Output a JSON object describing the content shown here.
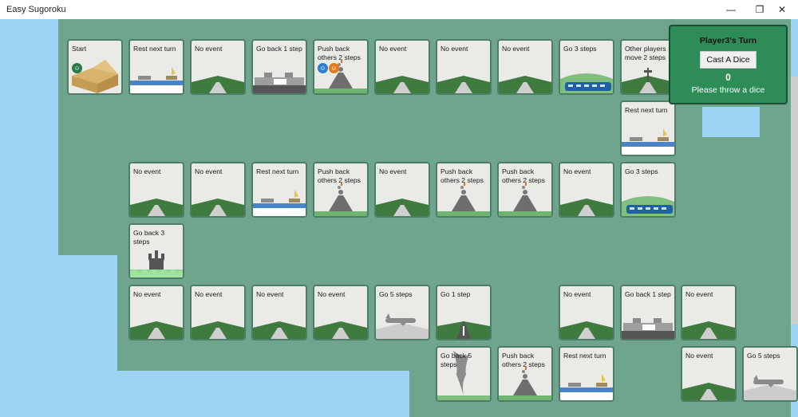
{
  "window": {
    "title": "Easy Sugoroku"
  },
  "panel": {
    "turn_text": "Player3's Turn",
    "cast_button": "Cast A Dice",
    "dice_value": "0",
    "message": "Please throw a dice"
  },
  "tiles": [
    {
      "label": "Start",
      "art": "box",
      "pawns": [
        "green"
      ]
    },
    {
      "label": "Rest next turn",
      "art": "sea"
    },
    {
      "label": "No event",
      "art": "road"
    },
    {
      "label": "Go back 1 step",
      "art": "traffic"
    },
    {
      "label": "Push back\nothers 2 steps",
      "art": "volcano",
      "pawns": [
        "blue",
        "orange"
      ]
    },
    {
      "label": "No event",
      "art": "road"
    },
    {
      "label": "No event",
      "art": "road"
    },
    {
      "label": "No event",
      "art": "road"
    },
    {
      "label": "Go 3 steps",
      "art": "train"
    },
    {
      "label": "Other players\nmove 2 steps",
      "art": "sign"
    },
    {
      "label": "Rest next turn",
      "art": "sea"
    },
    {
      "label": "No event",
      "art": "road"
    },
    {
      "label": "No event",
      "art": "road"
    },
    {
      "label": "Rest next turn",
      "art": "sea"
    },
    {
      "label": "Push back\nothers 2 steps",
      "art": "volcano"
    },
    {
      "label": "No event",
      "art": "road"
    },
    {
      "label": "Push back\nothers 2 steps",
      "art": "volcano"
    },
    {
      "label": "Push back\nothers 2 steps",
      "art": "volcano"
    },
    {
      "label": "No event",
      "art": "road"
    },
    {
      "label": "Go 3 steps",
      "art": "train"
    },
    {
      "label": "Go back 3 steps",
      "art": "castle"
    },
    {
      "label": "No event",
      "art": "road"
    },
    {
      "label": "No event",
      "art": "road"
    },
    {
      "label": "No event",
      "art": "road"
    },
    {
      "label": "No event",
      "art": "road"
    },
    {
      "label": "Go 5 steps",
      "art": "plane"
    },
    {
      "label": "Go 1 step",
      "art": "runway"
    },
    {
      "label": "No event",
      "art": "road"
    },
    {
      "label": "Go back 1 step",
      "art": "traffic"
    },
    {
      "label": "No event",
      "art": "road"
    },
    {
      "label": "Go back 5 steps",
      "art": "tornado"
    },
    {
      "label": "Push back\nothers 2 steps",
      "art": "volcano"
    },
    {
      "label": "Rest next turn",
      "art": "sea"
    },
    {
      "label": "No event",
      "art": "road"
    },
    {
      "label": "Go 5 steps",
      "art": "plane"
    }
  ],
  "colors": {
    "sea": "#9ed3f5",
    "land": "#6fa58c",
    "panel": "#2d8c58",
    "pawn_green": "#2a7a4a",
    "pawn_blue": "#2f7fd0",
    "pawn_orange": "#e07b1f"
  }
}
